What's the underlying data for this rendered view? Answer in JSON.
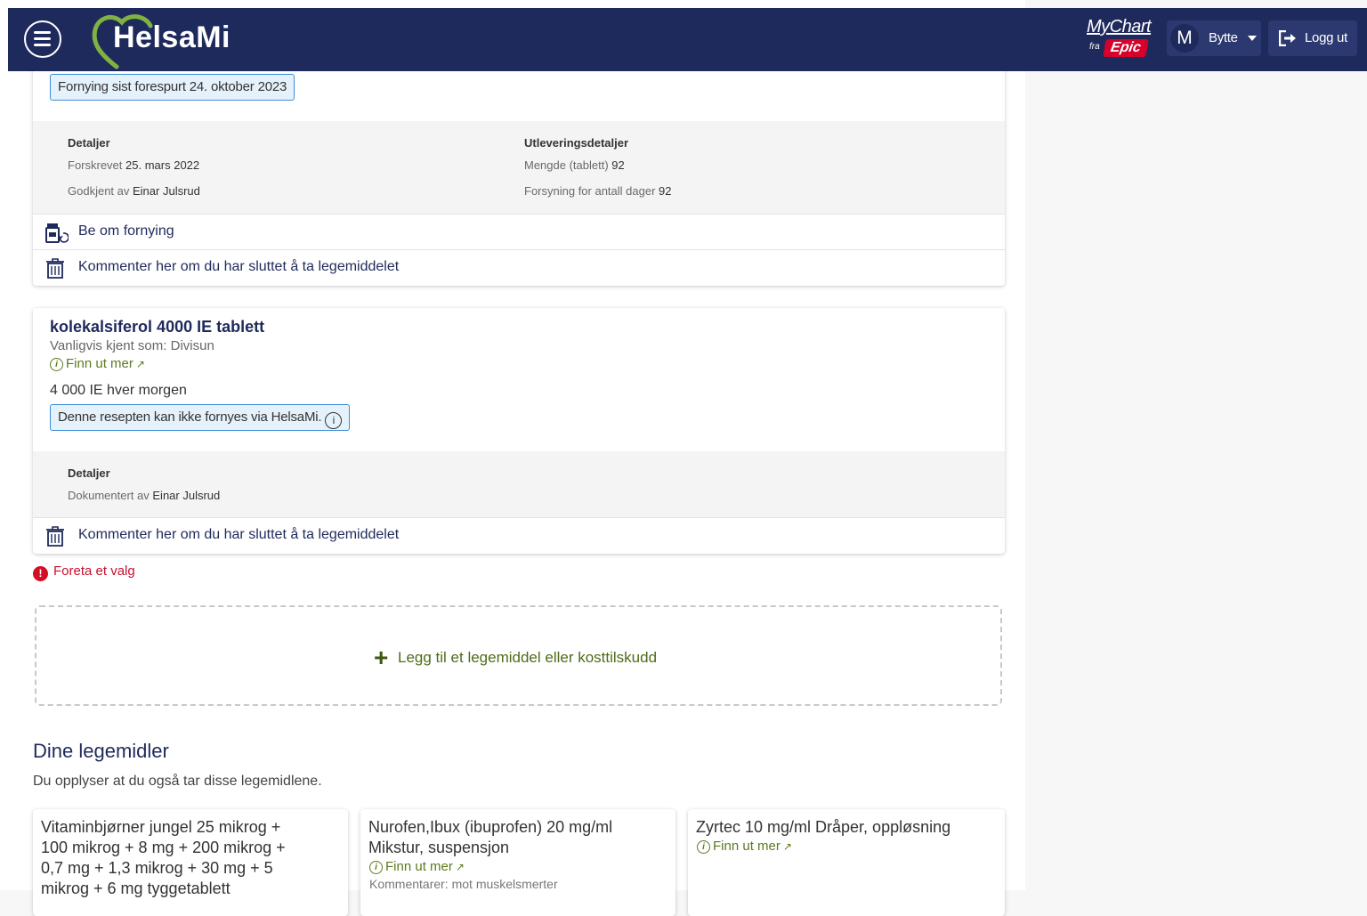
{
  "header": {
    "logo_text": "HelsaMi",
    "mychart_text": "MyChart",
    "mychart_fra": "fra",
    "mychart_epic": "Epic",
    "user_initial": "M",
    "switch_label": "Bytte",
    "logout_label": "Logg ut",
    "bg_color": "#1f2a5c"
  },
  "card1": {
    "renewal_badge": "Fornying sist forespurt 24. oktober 2023",
    "details_title": "Detaljer",
    "prescribed_label": "Forskrevet",
    "prescribed_value": "25. mars 2022",
    "approved_label": "Godkjent av",
    "approved_value": "Einar Julsrud",
    "dispense_title": "Utleveringsdetaljer",
    "quantity_label": "Mengde (tablett)",
    "quantity_value": "92",
    "supply_label": "Forsyning for antall dager",
    "supply_value": "92",
    "renew_action": "Be om fornying",
    "comment_action": "Kommenter her om du har sluttet å ta legemiddelet"
  },
  "card2": {
    "title": "kolekalsiferol 4000 IE tablett",
    "known_as": "Vanligvis kjent som: Divisun",
    "learn_more": "Finn ut mer",
    "dose": "4 000 IE hver morgen",
    "not_renewable_badge": "Denne resepten kan ikke fornyes via HelsaMi.",
    "details_title": "Detaljer",
    "documented_label": "Dokumentert av",
    "documented_value": "Einar Julsrud",
    "comment_action": "Kommenter her om du har sluttet å ta legemiddelet"
  },
  "validation": {
    "error_text": "Foreta et valg"
  },
  "add_medication": {
    "label": "Legg til et legemiddel eller kosttilskudd"
  },
  "your_meds": {
    "title": "Dine legemidler",
    "subtitle": "Du opplyser at du også tar disse legemidlene.",
    "items": [
      {
        "name": "Vitaminbjørner jungel 25 mikrog + 100 mikrog + 8 mg + 200 mikrog + 0,7 mg + 1,3 mikrog + 30 mg + 5 mikrog + 6 mg tyggetablett"
      },
      {
        "name": "Nurofen,Ibux (ibuprofen) 20 mg/ml Mikstur, suspensjon",
        "learn_more": "Finn ut mer",
        "comment": "Kommentarer: mot muskelsmerter"
      },
      {
        "name": "Zyrtec 10 mg/ml Dråper, oppløsning",
        "learn_more": "Finn ut mer"
      }
    ]
  }
}
